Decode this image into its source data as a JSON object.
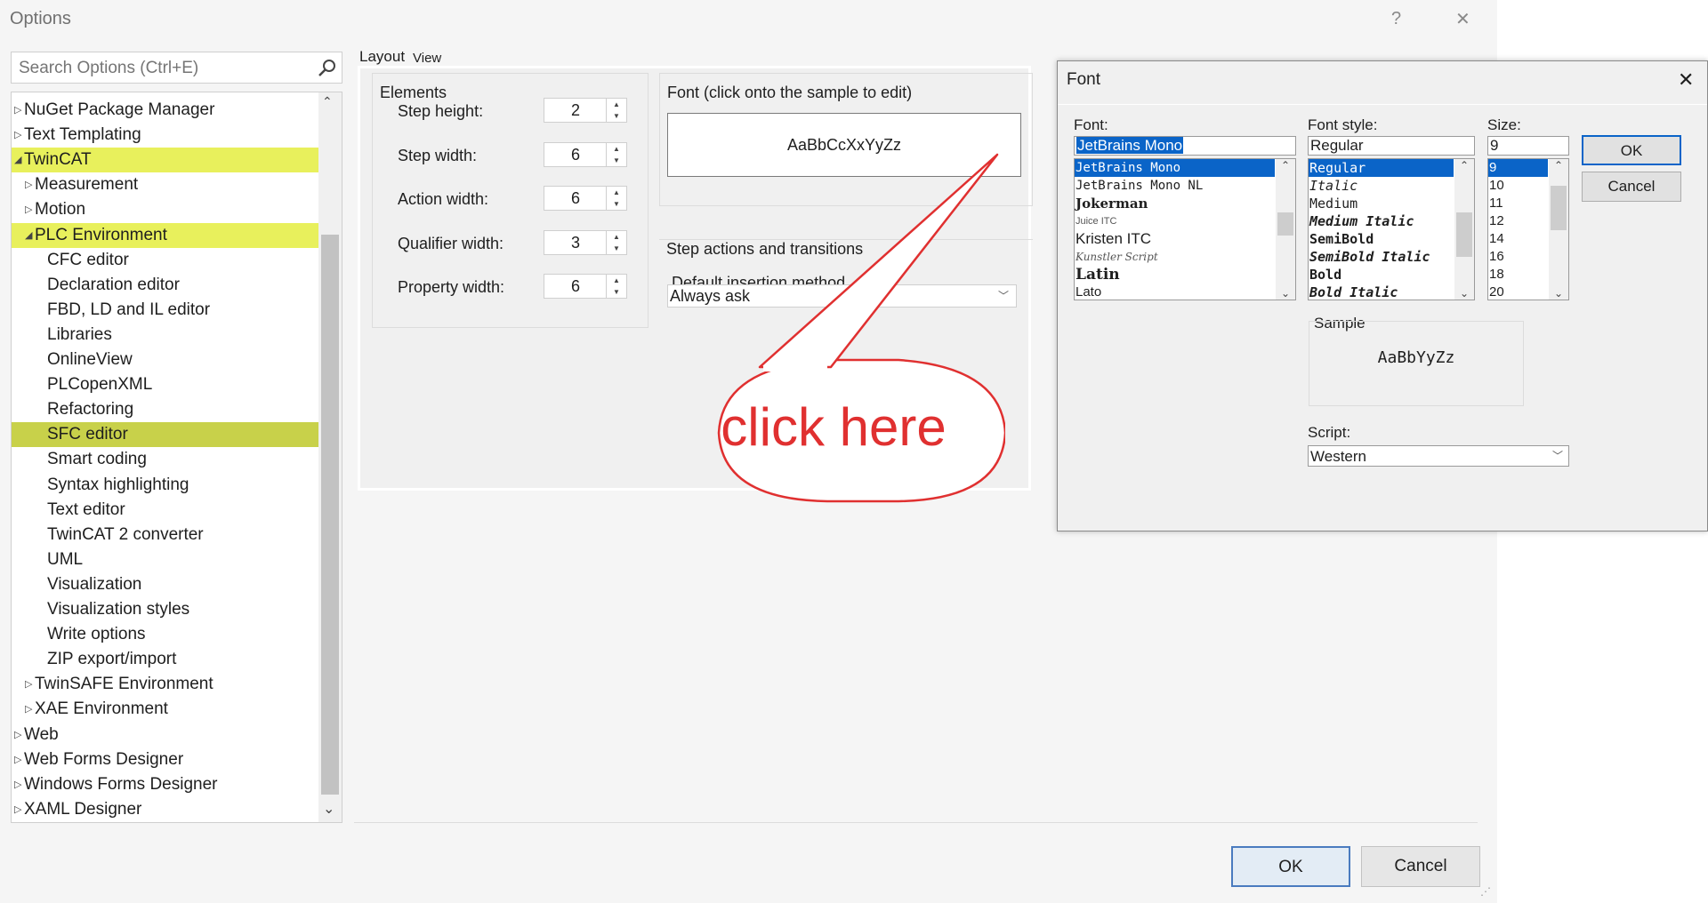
{
  "window": {
    "title": "Options",
    "help_glyph": "?",
    "close_glyph": "✕"
  },
  "search": {
    "placeholder": "Search Options (Ctrl+E)",
    "icon": "search-icon"
  },
  "tree": {
    "items": [
      {
        "label": "NuGet Package Manager",
        "expander": "▷",
        "highlight": "none"
      },
      {
        "label": "Text Templating",
        "expander": "▷",
        "highlight": "none"
      },
      {
        "label": "TwinCAT",
        "expander": "◢",
        "highlight": "yellow"
      },
      {
        "label": "Measurement",
        "expander": "▷",
        "highlight": "none"
      },
      {
        "label": "Motion",
        "expander": "▷",
        "highlight": "none"
      },
      {
        "label": "PLC Environment",
        "expander": "◢",
        "highlight": "yellow"
      },
      {
        "label": "CFC editor",
        "expander": "",
        "highlight": "none"
      },
      {
        "label": "Declaration editor",
        "expander": "",
        "highlight": "none"
      },
      {
        "label": "FBD, LD and IL editor",
        "expander": "",
        "highlight": "none"
      },
      {
        "label": "Libraries",
        "expander": "",
        "highlight": "none"
      },
      {
        "label": "OnlineView",
        "expander": "",
        "highlight": "none"
      },
      {
        "label": "PLCopenXML",
        "expander": "",
        "highlight": "none"
      },
      {
        "label": "Refactoring",
        "expander": "",
        "highlight": "none"
      },
      {
        "label": "SFC editor",
        "expander": "",
        "highlight": "selected"
      },
      {
        "label": "Smart coding",
        "expander": "",
        "highlight": "none"
      },
      {
        "label": "Syntax highlighting",
        "expander": "",
        "highlight": "none"
      },
      {
        "label": "Text editor",
        "expander": "",
        "highlight": "none"
      },
      {
        "label": "TwinCAT 2 converter",
        "expander": "",
        "highlight": "none"
      },
      {
        "label": "UML",
        "expander": "",
        "highlight": "none"
      },
      {
        "label": "Visualization",
        "expander": "",
        "highlight": "none"
      },
      {
        "label": "Visualization styles",
        "expander": "",
        "highlight": "none"
      },
      {
        "label": "Write options",
        "expander": "",
        "highlight": "none"
      },
      {
        "label": "ZIP export/import",
        "expander": "",
        "highlight": "none"
      },
      {
        "label": "TwinSAFE Environment",
        "expander": "▷",
        "highlight": "none"
      },
      {
        "label": "XAE Environment",
        "expander": "▷",
        "highlight": "none"
      },
      {
        "label": "Web",
        "expander": "▷",
        "highlight": "none"
      },
      {
        "label": "Web Forms Designer",
        "expander": "▷",
        "highlight": "none"
      },
      {
        "label": "Windows Forms Designer",
        "expander": "▷",
        "highlight": "none"
      },
      {
        "label": "XAML Designer",
        "expander": "▷",
        "highlight": "none"
      }
    ],
    "levels": [
      0,
      0,
      0,
      1,
      1,
      1,
      2,
      2,
      2,
      2,
      2,
      2,
      2,
      2,
      2,
      2,
      2,
      2,
      2,
      2,
      2,
      2,
      2,
      1,
      1,
      0,
      0,
      0,
      0
    ]
  },
  "content": {
    "layout_label": "Layout",
    "view_label": "View",
    "elements": {
      "title": "Elements",
      "fields": [
        {
          "label": "Step height:",
          "value": "2"
        },
        {
          "label": "Step width:",
          "value": "6"
        },
        {
          "label": "Action width:",
          "value": "6"
        },
        {
          "label": "Qualifier width:",
          "value": "3"
        },
        {
          "label": "Property width:",
          "value": "6"
        }
      ]
    },
    "font": {
      "title": "Font (click onto the sample to edit)",
      "sample": "AaBbCcXxYyZz"
    },
    "step_actions": {
      "title": "Step actions and transitions",
      "insertion_label": "Default insertion method",
      "insertion_value": "Always ask"
    }
  },
  "callout": {
    "text": "click here",
    "color": "#e03030"
  },
  "buttons": {
    "ok": "OK",
    "cancel": "Cancel"
  },
  "font_dialog": {
    "title": "Font",
    "font_label": "Font:",
    "font_value": "JetBrains Mono",
    "font_list": [
      "JetBrains Mono",
      "JetBrains Mono NL",
      "Jokerman",
      "Juice ITC",
      "Kristen ITC",
      "Kunstler Script",
      "Latin",
      "Lato"
    ],
    "style_label": "Font style:",
    "style_value": "Regular",
    "style_list": [
      "Regular",
      "Italic",
      "Medium",
      "Medium Italic",
      "SemiBold",
      "SemiBold Italic",
      "Bold",
      "Bold Italic"
    ],
    "size_label": "Size:",
    "size_value": "9",
    "size_list": [
      "9",
      "10",
      "11",
      "12",
      "14",
      "16",
      "18",
      "20"
    ],
    "ok": "OK",
    "cancel": "Cancel",
    "sample_label": "Sample",
    "sample_text": "AaBbYyZz",
    "script_label": "Script:",
    "script_value": "Western"
  }
}
